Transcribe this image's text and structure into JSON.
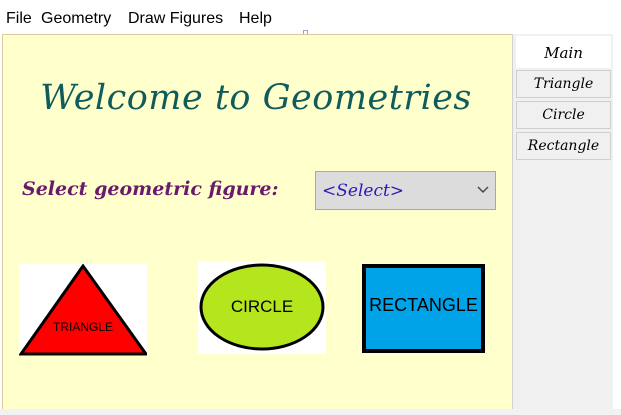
{
  "menubar": {
    "items": [
      {
        "label": "File"
      },
      {
        "label": "Geometry"
      },
      {
        "label": "Draw Figures"
      },
      {
        "label": "Help"
      }
    ]
  },
  "main": {
    "welcome": "Welcome to Geometries",
    "select_label": "Select geometric figure:",
    "select_value": "<Select>"
  },
  "figures": {
    "triangle": {
      "label": "TRIANGLE",
      "fill": "#ff0000"
    },
    "circle": {
      "label": "CIRCLE",
      "fill": "#b5e61d"
    },
    "rectangle": {
      "label": "RECTANGLE",
      "fill": "#00a2e8"
    }
  },
  "tabs": [
    {
      "label": "Main"
    },
    {
      "label": "Triangle"
    },
    {
      "label": "Circle"
    },
    {
      "label": "Rectangle"
    }
  ],
  "colors": {
    "content_bg": "#ffffcc",
    "welcome_text": "#105c5c",
    "select_label_text": "#6b1a6b",
    "select_value_text": "#2a1ab5"
  }
}
